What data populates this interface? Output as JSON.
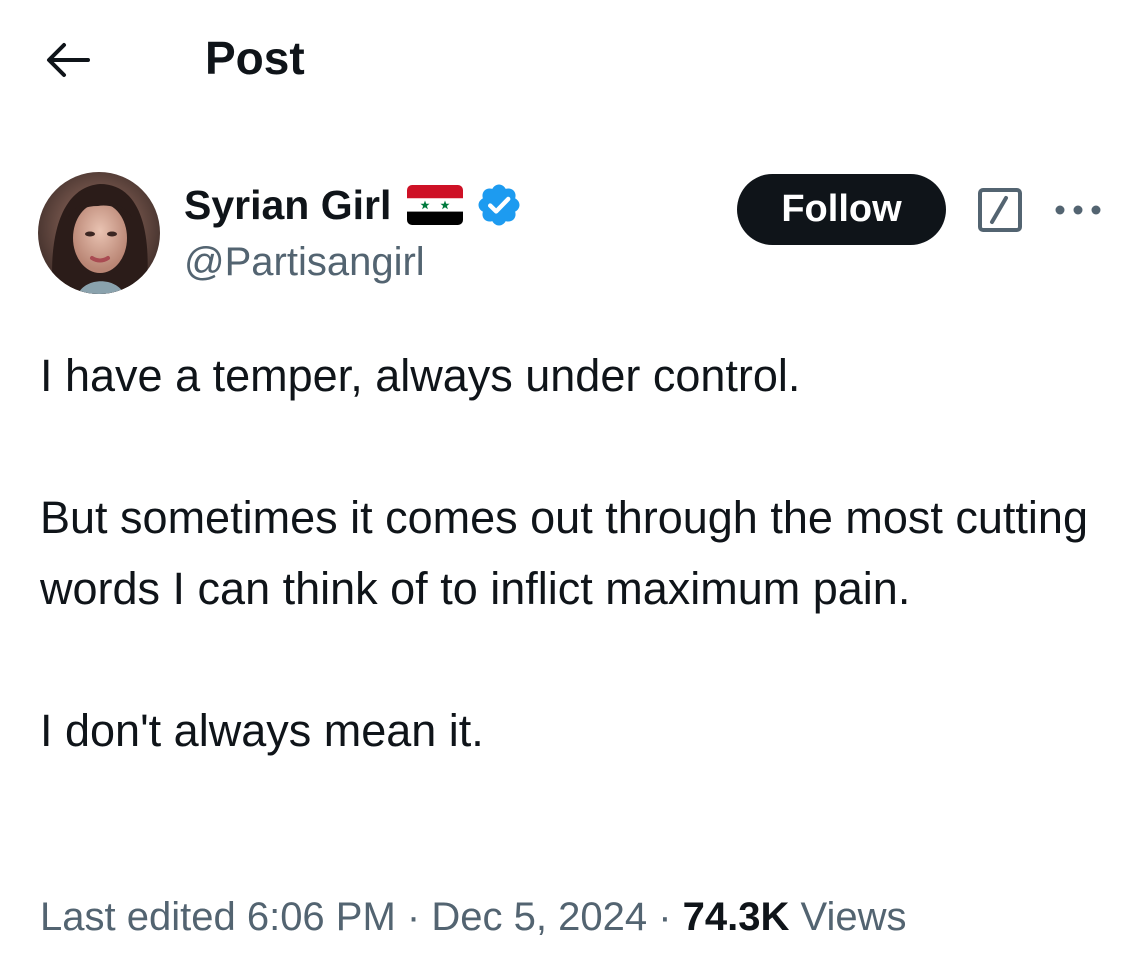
{
  "header": {
    "back_icon": "arrow-left-icon",
    "title": "Post"
  },
  "author": {
    "display_name": "Syrian Girl",
    "flag_icon": "syria-flag-icon",
    "verified_icon": "verified-badge-icon",
    "verified_color": "#1d9bf0",
    "handle": "@Partisangirl"
  },
  "actions": {
    "follow_label": "Follow",
    "grok_icon": "grok-icon",
    "more_icon": "more-options-icon"
  },
  "tweet": {
    "paragraphs": [
      "I have a temper, always under control.",
      "But sometimes it comes out through the most cutting words I can think of to inflict maximum pain.",
      "I don't always mean it."
    ]
  },
  "meta": {
    "prefix": "Last edited",
    "time": "6:06 PM",
    "separator": "·",
    "date": "Dec 5, 2024",
    "views_count": "74.3K",
    "views_label": "Views"
  },
  "colors": {
    "text_primary": "#0f1419",
    "text_secondary": "#536471",
    "button_bg": "#0f1419",
    "button_text": "#ffffff"
  }
}
